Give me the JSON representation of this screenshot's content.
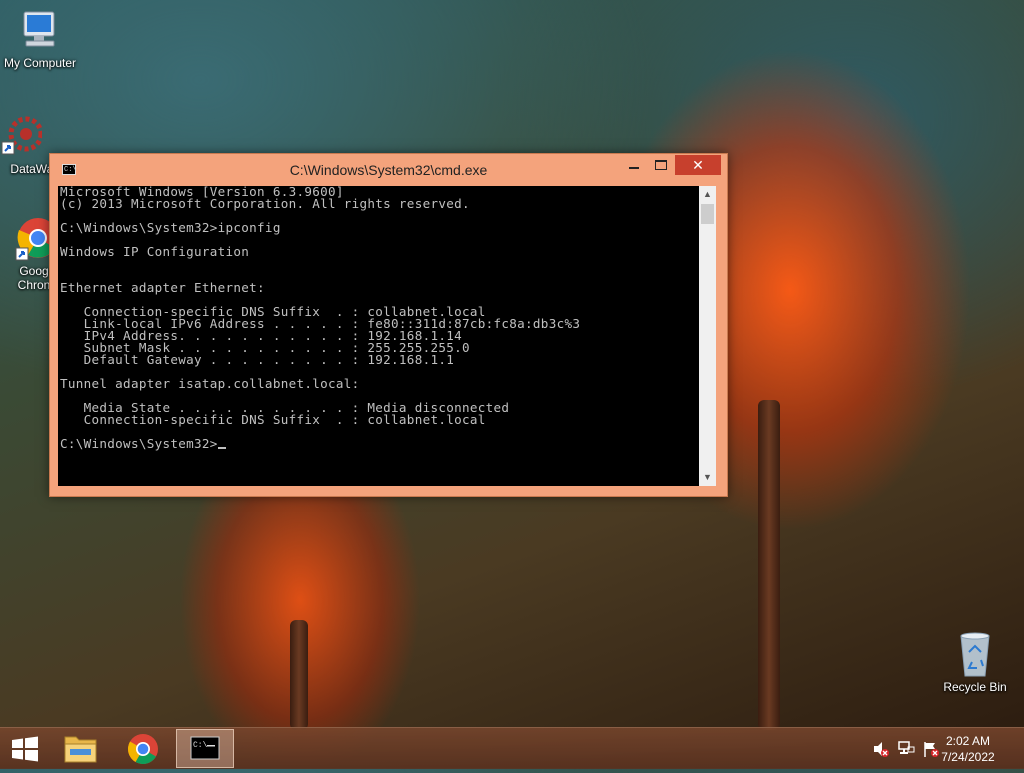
{
  "desktop": {
    "icons": [
      {
        "name": "my-computer",
        "label": "My Computer"
      },
      {
        "name": "datawagon",
        "label": "DataWag"
      },
      {
        "name": "google-chrome",
        "label": "Goog",
        "label2": "Chron"
      },
      {
        "name": "recycle-bin",
        "label": "Recycle Bin"
      }
    ]
  },
  "cmd_window": {
    "title": "C:\\Windows\\System32\\cmd.exe",
    "close_glyph": "✕",
    "lines": [
      "Microsoft Windows [Version 6.3.9600]",
      "(c) 2013 Microsoft Corporation. All rights reserved.",
      "",
      "C:\\Windows\\System32>ipconfig",
      "",
      "Windows IP Configuration",
      "",
      "",
      "Ethernet adapter Ethernet:",
      "",
      "   Connection-specific DNS Suffix  . : collabnet.local",
      "   Link-local IPv6 Address . . . . . : fe80::311d:87cb:fc8a:db3c%3",
      "   IPv4 Address. . . . . . . . . . . : 192.168.1.14",
      "   Subnet Mask . . . . . . . . . . . : 255.255.255.0",
      "   Default Gateway . . . . . . . . . : 192.168.1.1",
      "",
      "Tunnel adapter isatap.collabnet.local:",
      "",
      "   Media State . . . . . . . . . . . : Media disconnected",
      "   Connection-specific DNS Suffix  . : collabnet.local",
      ""
    ],
    "prompt": "C:\\Windows\\System32>"
  },
  "taskbar": {
    "clock_time": "2:02 AM",
    "clock_date": "7/24/2022"
  },
  "colors": {
    "window_frame": "#f4a37c",
    "close_button": "#c7402d",
    "console_bg": "#000000",
    "console_text": "#c0c0c0"
  }
}
